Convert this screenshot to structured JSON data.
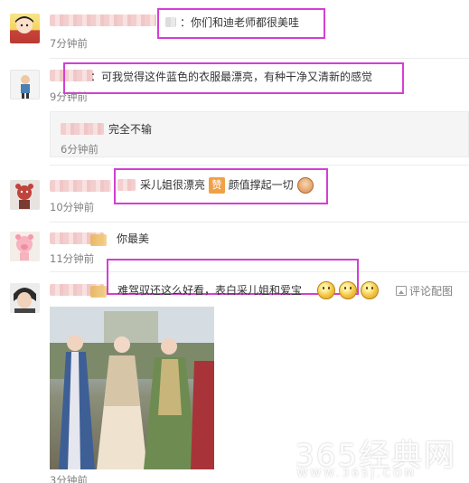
{
  "comments": [
    {
      "text": "：你们和迪老师都很美哇",
      "time": "7分钟前"
    },
    {
      "text": "：可我觉得这件蓝色的衣服最漂亮，有种干净又清新的感觉",
      "time": "9分钟前",
      "reply": {
        "text": "完全不输",
        "time": "6分钟前"
      }
    },
    {
      "text": "采儿姐很漂亮",
      "badge": "赞",
      "text2": "颜值撑起一切",
      "time": "10分钟前"
    },
    {
      "text": "你最美",
      "time": "11分钟前"
    },
    {
      "text": "难驾驭还这么好看，表白采儿姐和爱宝",
      "time": "3分钟前",
      "action": "评论配图"
    }
  ],
  "watermark": {
    "main": "365经典网",
    "sub": "WWW.365J.COM"
  },
  "colors": {
    "highlight": "#d43fd3",
    "time": "#808080",
    "divider": "#ececec"
  }
}
